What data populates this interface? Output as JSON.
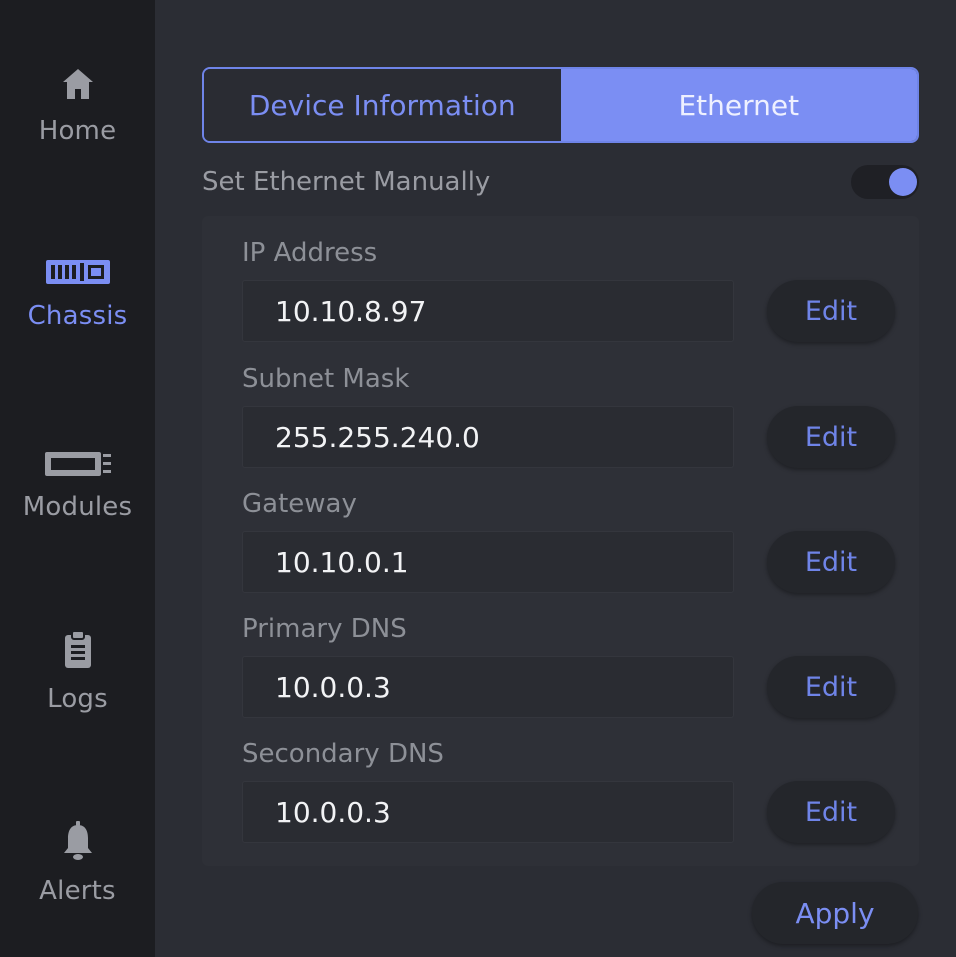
{
  "sidebar": {
    "items": [
      {
        "label": "Home",
        "icon": "home-icon"
      },
      {
        "label": "Chassis",
        "icon": "chassis-icon"
      },
      {
        "label": "Modules",
        "icon": "module-icon"
      },
      {
        "label": "Logs",
        "icon": "clipboard-icon"
      },
      {
        "label": "Alerts",
        "icon": "bell-icon"
      }
    ],
    "active": "Chassis"
  },
  "tabs": {
    "device_information": "Device Information",
    "ethernet": "Ethernet",
    "active": "Ethernet"
  },
  "manual": {
    "label": "Set Ethernet Manually",
    "enabled": true
  },
  "fields": [
    {
      "label": "IP Address",
      "value": "10.10.8.97",
      "button": "Edit"
    },
    {
      "label": "Subnet Mask",
      "value": "255.255.240.0",
      "button": "Edit"
    },
    {
      "label": "Gateway",
      "value": "10.10.0.1",
      "button": "Edit"
    },
    {
      "label": "Primary DNS",
      "value": "10.0.0.3",
      "button": "Edit"
    },
    {
      "label": "Secondary DNS",
      "value": "10.0.0.3",
      "button": "Edit"
    }
  ],
  "apply_label": "Apply",
  "colors": {
    "accent": "#7b8ef3",
    "sidebar_bg": "#1c1d21",
    "main_bg": "#2b2d34",
    "text_muted": "#9a9ca3"
  }
}
